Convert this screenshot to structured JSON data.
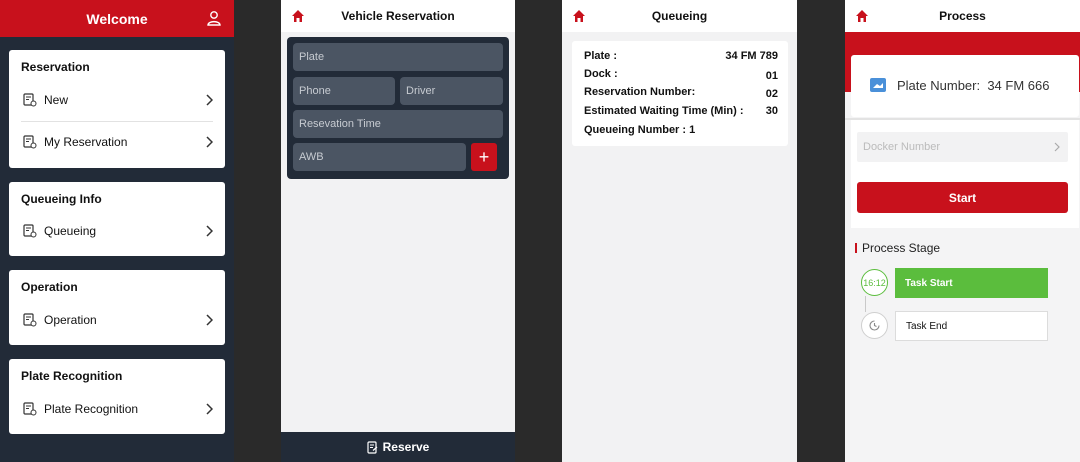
{
  "panel1": {
    "header_title": "Welcome",
    "sections": [
      {
        "title": "Reservation",
        "items": [
          "New",
          "My Reservation"
        ]
      },
      {
        "title": "Queueing Info",
        "items": [
          "Queueing"
        ]
      },
      {
        "title": "Operation",
        "items": [
          "Operation"
        ]
      },
      {
        "title": "Plate Recognition",
        "items": [
          "Plate Recognition"
        ]
      }
    ]
  },
  "panel2": {
    "header_title": "Vehicle Reservation",
    "fields": {
      "plate": "Plate",
      "phone": "Phone",
      "driver": "Driver",
      "reservation_time": "Resevation Time",
      "awb": "AWB"
    },
    "add_label": "+",
    "footer_label": "Reserve"
  },
  "panel3": {
    "header_title": "Queueing",
    "rows": [
      {
        "label": "Plate :",
        "value": "34 FM 789"
      },
      {
        "label": "Dock :",
        "value": "01"
      },
      {
        "label": "Reservation Number:",
        "value": "02"
      },
      {
        "label": "Estimated Waiting Time (Min) :",
        "value": "30"
      },
      {
        "label": "Queueing Number : 1",
        "value": ""
      }
    ]
  },
  "panel4": {
    "header_title": "Process",
    "plate_text": "Plate Number:  34 FM 666",
    "docker_placeholder": "Docker Number",
    "start_label": "Start",
    "stage_title": "Process Stage",
    "stages": [
      {
        "time": "16:12",
        "label": "Task Start",
        "done": true
      },
      {
        "time": "",
        "label": "Task End",
        "done": false
      }
    ]
  },
  "colors": {
    "brand_red": "#c8111c",
    "navy": "#222b38",
    "success_green": "#5bbd3d"
  }
}
